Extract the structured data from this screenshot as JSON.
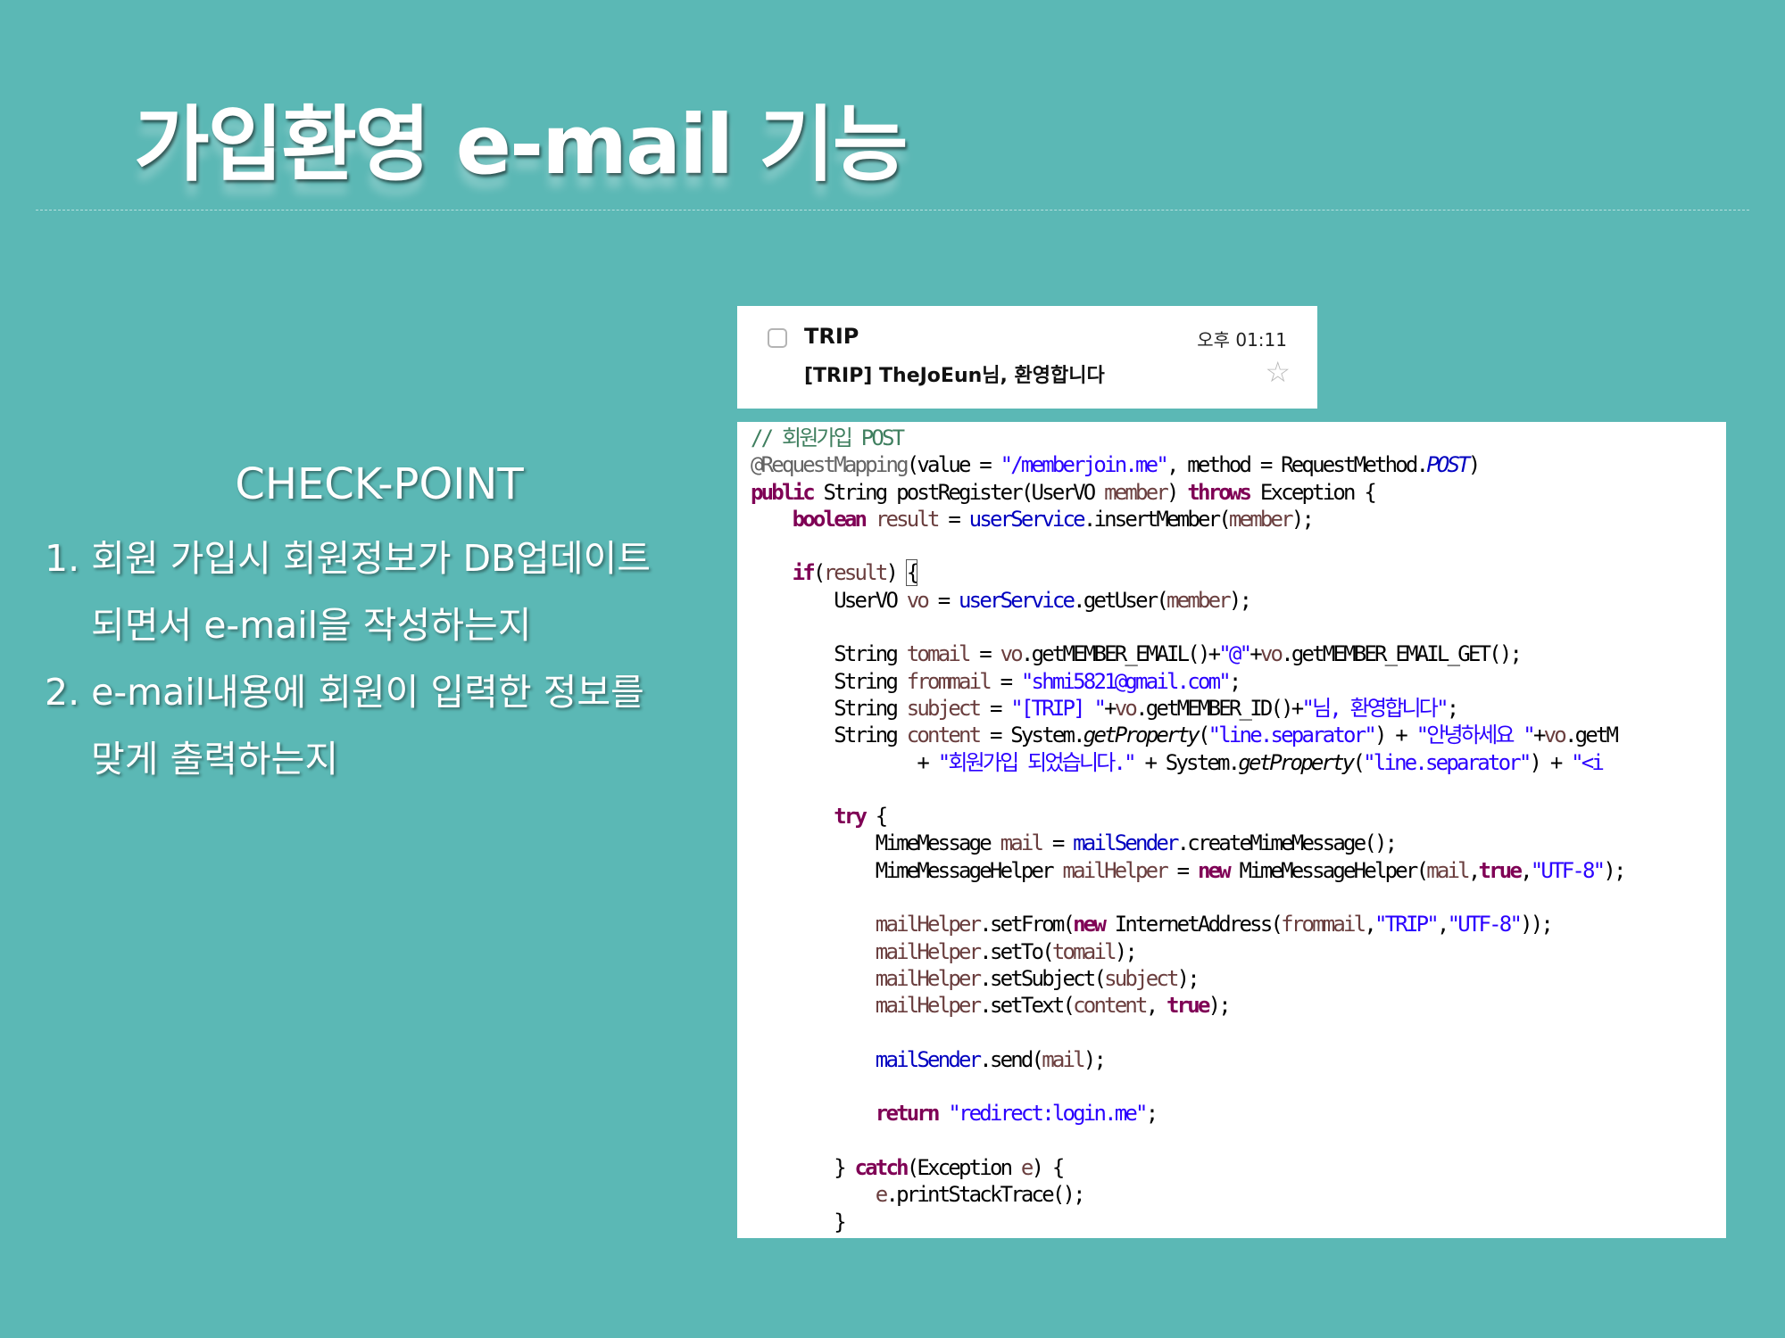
{
  "slide": {
    "title": "가입환영 e-mail 기능"
  },
  "checkpoint": {
    "heading": "CHECK-POINT",
    "item1_line1": "1. 회원 가입시 회원정보가 DB업데이트",
    "item1_line2": "되면서 e-mail을 작성하는지",
    "item2_line1": "2. e-mail내용에 회원이 입력한 정보를",
    "item2_line2": "맞게 출력하는지"
  },
  "email": {
    "sender": "TRIP",
    "time": "오후 01:11",
    "subject": "[TRIP] TheJoEun님, 환영합니다",
    "star_icon": "star-outline",
    "checkbox_icon": "checkbox-unchecked"
  },
  "code": [
    [
      [
        "// 회원가입 POST",
        "cm"
      ]
    ],
    [
      [
        "@RequestMapping",
        "an"
      ],
      [
        "(value = ",
        ""
      ],
      [
        "\"/memberjoin.me\"",
        "st"
      ],
      [
        ", method = RequestMethod.",
        ""
      ],
      [
        "POST",
        "itfd"
      ],
      [
        ")",
        ""
      ]
    ],
    [
      [
        "public",
        "kw"
      ],
      [
        " String postRegister(UserVO ",
        ""
      ],
      [
        "member",
        "lv"
      ],
      [
        ") ",
        ""
      ],
      [
        "throws",
        "kw"
      ],
      [
        " Exception {",
        ""
      ]
    ],
    [
      [
        "    ",
        ""
      ],
      [
        "boolean",
        "kw"
      ],
      [
        " ",
        ""
      ],
      [
        "result",
        "lv"
      ],
      [
        " = ",
        ""
      ],
      [
        "userService",
        "fd"
      ],
      [
        ".insertMember(",
        ""
      ],
      [
        "member",
        "lv"
      ],
      [
        ");",
        ""
      ]
    ],
    [],
    [
      [
        "    ",
        ""
      ],
      [
        "if",
        "kw"
      ],
      [
        "(",
        ""
      ],
      [
        "result",
        "lv"
      ],
      [
        ") ",
        ""
      ],
      [
        "{",
        "brk"
      ]
    ],
    [
      [
        "        UserVO ",
        ""
      ],
      [
        "vo",
        "lv"
      ],
      [
        " = ",
        ""
      ],
      [
        "userService",
        "fd"
      ],
      [
        ".getUser(",
        ""
      ],
      [
        "member",
        "lv"
      ],
      [
        ");",
        ""
      ]
    ],
    [],
    [
      [
        "        String ",
        ""
      ],
      [
        "tomail",
        "lv"
      ],
      [
        " = ",
        ""
      ],
      [
        "vo",
        "lv"
      ],
      [
        ".getMEMBER_EMAIL()+",
        ""
      ],
      [
        "\"@\"",
        "st"
      ],
      [
        "+",
        ""
      ],
      [
        "vo",
        "lv"
      ],
      [
        ".getMEMBER_EMAIL_GET();",
        ""
      ]
    ],
    [
      [
        "        String ",
        ""
      ],
      [
        "frommail",
        "lv"
      ],
      [
        " = ",
        ""
      ],
      [
        "\"shmi5821@gmail.com\"",
        "st"
      ],
      [
        ";",
        ""
      ]
    ],
    [
      [
        "        String ",
        ""
      ],
      [
        "subject",
        "lv"
      ],
      [
        " = ",
        ""
      ],
      [
        "\"[TRIP] \"",
        "st"
      ],
      [
        "+",
        ""
      ],
      [
        "vo",
        "lv"
      ],
      [
        ".getMEMBER_ID()+",
        ""
      ],
      [
        "\"님, 환영합니다\"",
        "st"
      ],
      [
        ";",
        ""
      ]
    ],
    [
      [
        "        String ",
        ""
      ],
      [
        "content",
        "lv"
      ],
      [
        " = System.",
        ""
      ],
      [
        "getProperty",
        "it"
      ],
      [
        "(",
        ""
      ],
      [
        "\"line.separator\"",
        "st"
      ],
      [
        ") + ",
        ""
      ],
      [
        "\"안녕하세요 \"",
        "st"
      ],
      [
        "+",
        ""
      ],
      [
        "vo",
        "lv"
      ],
      [
        ".getM",
        ""
      ]
    ],
    [
      [
        "                + ",
        ""
      ],
      [
        "\"회원가입 되었습니다.\"",
        "st"
      ],
      [
        " + System.",
        ""
      ],
      [
        "getProperty",
        "it"
      ],
      [
        "(",
        ""
      ],
      [
        "\"line.separator\"",
        "st"
      ],
      [
        ") + ",
        ""
      ],
      [
        "\"<i",
        "st"
      ]
    ],
    [],
    [
      [
        "        ",
        ""
      ],
      [
        "try",
        "kw"
      ],
      [
        " {",
        ""
      ]
    ],
    [
      [
        "            MimeMessage ",
        ""
      ],
      [
        "mail",
        "lv"
      ],
      [
        " = ",
        ""
      ],
      [
        "mailSender",
        "fd"
      ],
      [
        ".createMimeMessage();",
        ""
      ]
    ],
    [
      [
        "            MimeMessageHelper ",
        ""
      ],
      [
        "mailHelper",
        "lv"
      ],
      [
        " = ",
        ""
      ],
      [
        "new",
        "kw"
      ],
      [
        " MimeMessageHelper(",
        ""
      ],
      [
        "mail",
        "lv"
      ],
      [
        ",",
        ""
      ],
      [
        "true",
        "kw"
      ],
      [
        ",",
        ""
      ],
      [
        "\"UTF-8\"",
        "st"
      ],
      [
        ");",
        ""
      ]
    ],
    [],
    [
      [
        "            ",
        ""
      ],
      [
        "mailHelper",
        "lv"
      ],
      [
        ".setFrom(",
        ""
      ],
      [
        "new",
        "kw"
      ],
      [
        " InternetAddress(",
        ""
      ],
      [
        "frommail",
        "lv"
      ],
      [
        ",",
        ""
      ],
      [
        "\"TRIP\"",
        "st"
      ],
      [
        ",",
        ""
      ],
      [
        "\"UTF-8\"",
        "st"
      ],
      [
        "));",
        ""
      ]
    ],
    [
      [
        "            ",
        ""
      ],
      [
        "mailHelper",
        "lv"
      ],
      [
        ".setTo(",
        ""
      ],
      [
        "tomail",
        "lv"
      ],
      [
        ");",
        ""
      ]
    ],
    [
      [
        "            ",
        ""
      ],
      [
        "mailHelper",
        "lv"
      ],
      [
        ".setSubject(",
        ""
      ],
      [
        "subject",
        "lv"
      ],
      [
        ");",
        ""
      ]
    ],
    [
      [
        "            ",
        ""
      ],
      [
        "mailHelper",
        "lv"
      ],
      [
        ".setText(",
        ""
      ],
      [
        "content",
        "lv"
      ],
      [
        ", ",
        ""
      ],
      [
        "true",
        "kw"
      ],
      [
        ");",
        ""
      ]
    ],
    [],
    [
      [
        "            ",
        ""
      ],
      [
        "mailSender",
        "fd"
      ],
      [
        ".send(",
        ""
      ],
      [
        "mail",
        "lv"
      ],
      [
        ");",
        ""
      ]
    ],
    [],
    [
      [
        "            ",
        ""
      ],
      [
        "return",
        "kw"
      ],
      [
        " ",
        ""
      ],
      [
        "\"redirect:login.me\"",
        "st"
      ],
      [
        ";",
        ""
      ]
    ],
    [],
    [
      [
        "        } ",
        ""
      ],
      [
        "catch",
        "kw"
      ],
      [
        "(Exception ",
        ""
      ],
      [
        "e",
        "lv"
      ],
      [
        ") {",
        ""
      ]
    ],
    [
      [
        "            ",
        ""
      ],
      [
        "e",
        "lv"
      ],
      [
        ".printStackTrace();",
        ""
      ]
    ],
    [
      [
        "        }",
        ""
      ]
    ]
  ]
}
